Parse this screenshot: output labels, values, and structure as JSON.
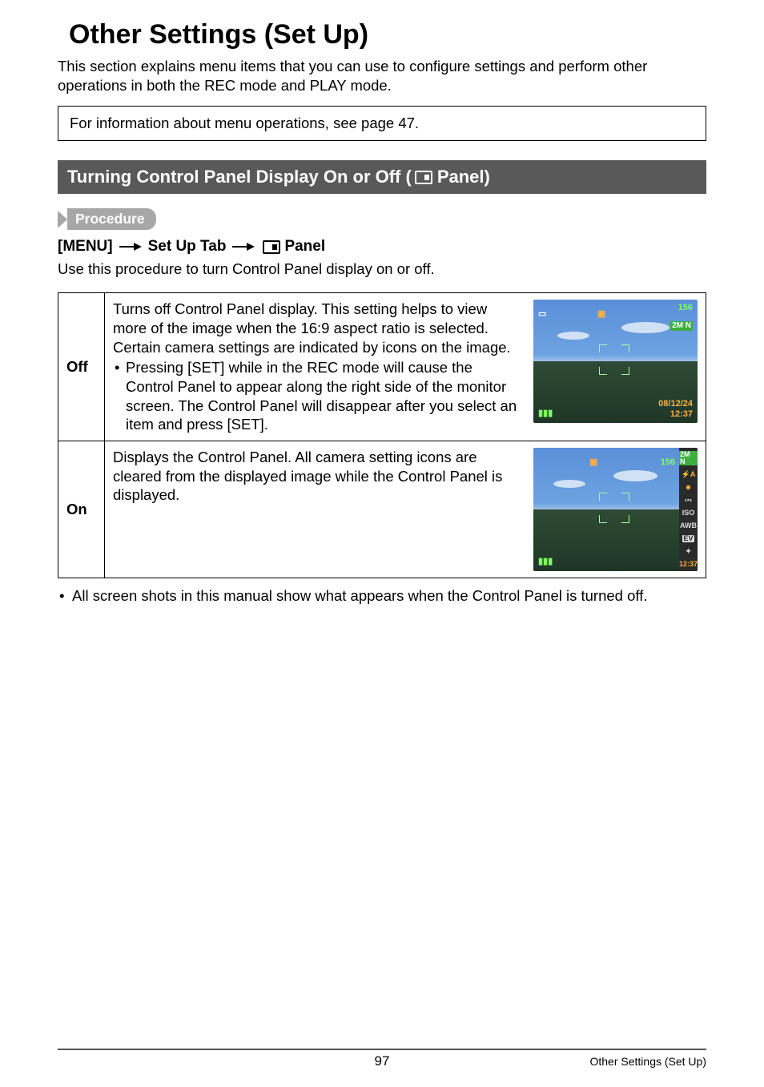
{
  "chapter_title": "Other Settings (Set Up)",
  "intro_text": "This section explains menu items that you can use to configure settings and perform other operations in both the REC mode and PLAY mode.",
  "info_box_text": "For information about menu operations, see page 47.",
  "section_header": {
    "prefix": "Turning Control Panel Display On or Off (",
    "suffix": " Panel)"
  },
  "procedure_label": "Procedure",
  "procedure_path": {
    "step1": "[MENU]",
    "step2": "Set Up Tab",
    "step3_suffix": " Panel"
  },
  "procedure_desc": "Use this procedure to turn Control Panel display on or off.",
  "table": {
    "rows": [
      {
        "label": "Off",
        "text_main": "Turns off Control Panel display. This setting helps to view more of the image when the 16:9 aspect ratio is selected. Certain camera settings are indicated by icons on the image.",
        "bullet": "Pressing [SET] while in the REC mode will cause the Control Panel to appear along the right side of the monitor screen. The Control Panel will disappear after you select an item and press [SET].",
        "overlay": {
          "top_right_count": "156",
          "top_right_badge": "2M N",
          "bottom_right_date": "08/12/24",
          "bottom_right_time": "12:37",
          "battery": "▮▮▮"
        }
      },
      {
        "label": "On",
        "text_main": "Displays the Control Panel. All camera setting icons are cleared from the displayed image while the Control Panel is displayed.",
        "overlay": {
          "top_right_count": "156",
          "panel_items": [
            "2M N",
            "⚡A",
            "☻",
            "‹▪›",
            "ISO",
            "AWB",
            "EV",
            "✦",
            "12:37"
          ],
          "battery": "▮▮▮"
        }
      }
    ]
  },
  "footnote": "All screen shots in this manual show what appears when the Control Panel is turned off.",
  "footer": {
    "page_number": "97",
    "chapter": "Other Settings (Set Up)"
  }
}
